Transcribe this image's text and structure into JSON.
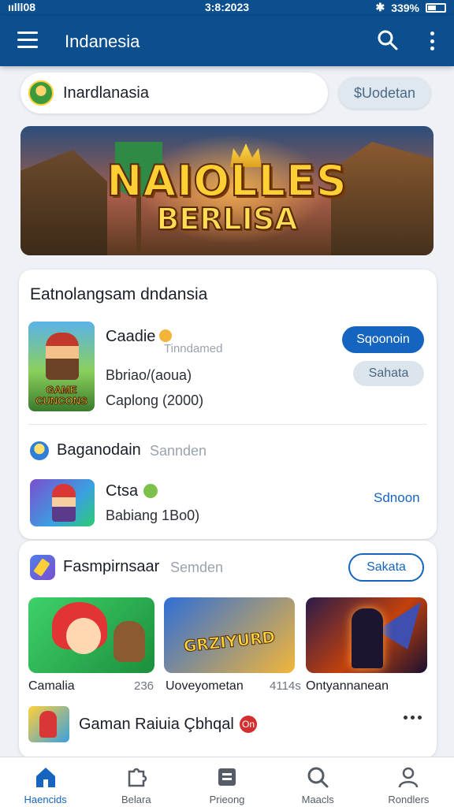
{
  "status_bar": {
    "left": "ıılll08",
    "time": "3:8:2023",
    "battery": "339%"
  },
  "app_bar": {
    "title": "Indanesia"
  },
  "region_selector": {
    "label": "Inardlanasia",
    "update_button": "$Uodetan"
  },
  "banner": {
    "logo_line1": "NAIOLLES",
    "logo_line2": "BERLISA"
  },
  "section_featured": {
    "title": "Eatnolangsam dndansia",
    "item1": {
      "name": "Caadie",
      "ghost": "Tinndamed",
      "sub1": "Bbriao/(aoua)",
      "sub2": "Caplong (2000)",
      "thumb_text": "GAME CUNCONS",
      "btn_primary": "Sqoonoin",
      "btn_secondary": "Sahata"
    },
    "subsection": {
      "title": "Baganodain",
      "ghost": "Sannden"
    },
    "item2": {
      "name": "Ctsa",
      "sub": "Babiang 1Bo0)",
      "link": "Sdnoon"
    }
  },
  "section_games": {
    "title": "Fasmpirnsaar",
    "ghost": "Semden",
    "btn": "Sakata",
    "games": [
      {
        "caption": "Camalia",
        "num": "236"
      },
      {
        "caption": "Uoveyometan",
        "num": "4114s",
        "logo": "GRZIYURD"
      },
      {
        "caption": "Ontyannanean",
        "num": ""
      }
    ],
    "footer_title": "Gaman Raiuia Çbhqal",
    "footer_badge": "On"
  },
  "bottom_nav": [
    {
      "label": "Haencids"
    },
    {
      "label": "Belara"
    },
    {
      "label": "Prieong"
    },
    {
      "label": "Maacls"
    },
    {
      "label": "Rondlers"
    }
  ],
  "colors": {
    "primary": "#0b4f8f",
    "accent": "#1565c0",
    "background": "#eef1f6"
  }
}
